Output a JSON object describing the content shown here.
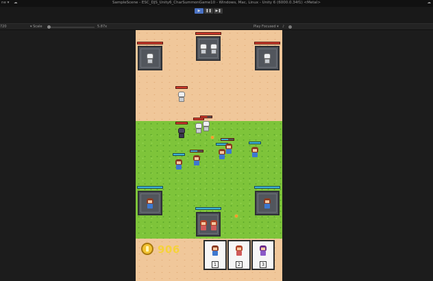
{
  "window": {
    "title": "SampleScene - ESC_DJS_Unity6_CharSummonGame10 - Windows, Mac, Linux - Unity 6 (6000.0.34f1) <Metal>",
    "left_label": "ne ▾",
    "left_icon": "cloud-icon"
  },
  "toolbar": {
    "play_icon": "play-icon",
    "pause_icon": "pause-icon",
    "step_icon": "step-icon"
  },
  "gamebar": {
    "resolution": "720",
    "scale_label": "▾ Scale",
    "scale_value": "5.87x",
    "play_focused": "Play Focused ▾",
    "mute_icon": "speaker-icon"
  },
  "game": {
    "colors": {
      "sand": "#f0c79a",
      "grass": "#7ec43a",
      "enemy_hp": "#d23c2c",
      "ally_hp": "#3fb4d6",
      "coin": "#f2c232"
    },
    "coins": "906",
    "cards": [
      {
        "number": "1",
        "unit": "blue-hero-icon"
      },
      {
        "number": "2",
        "unit": "red-hero-icon"
      },
      {
        "number": "3",
        "unit": "purple-hero-icon"
      }
    ]
  }
}
